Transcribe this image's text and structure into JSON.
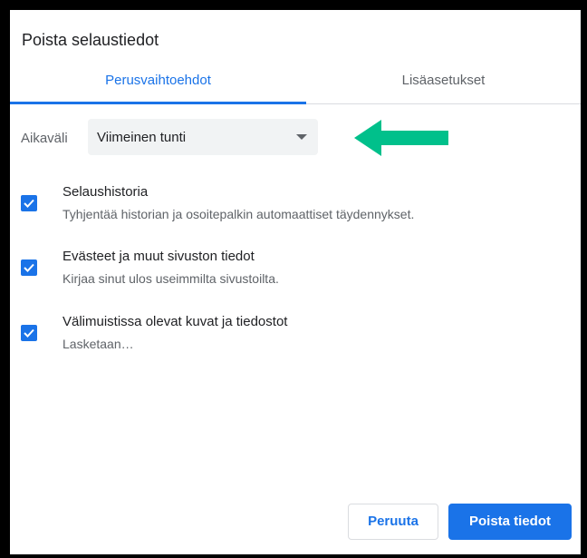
{
  "dialog": {
    "title": "Poista selaustiedot"
  },
  "tabs": [
    {
      "label": "Perusvaihtoehdot",
      "active": true
    },
    {
      "label": "Lisäasetukset",
      "active": false
    }
  ],
  "time_range": {
    "label": "Aikaväli",
    "selected": "Viimeinen tunti"
  },
  "annotation": {
    "arrow_color": "#00c08b"
  },
  "options": [
    {
      "title": "Selaushistoria",
      "description": "Tyhjentää historian ja osoitepalkin automaattiset täydennykset.",
      "checked": true
    },
    {
      "title": "Evästeet ja muut sivuston tiedot",
      "description": "Kirjaa sinut ulos useimmilta sivustoilta.",
      "checked": true
    },
    {
      "title": "Välimuistissa olevat kuvat ja tiedostot",
      "description": "Lasketaan…",
      "checked": true
    }
  ],
  "buttons": {
    "cancel_label": "Peruuta",
    "clear_label": "Poista tiedot"
  },
  "colors": {
    "accent": "#1a73e8",
    "border": "#000000"
  }
}
